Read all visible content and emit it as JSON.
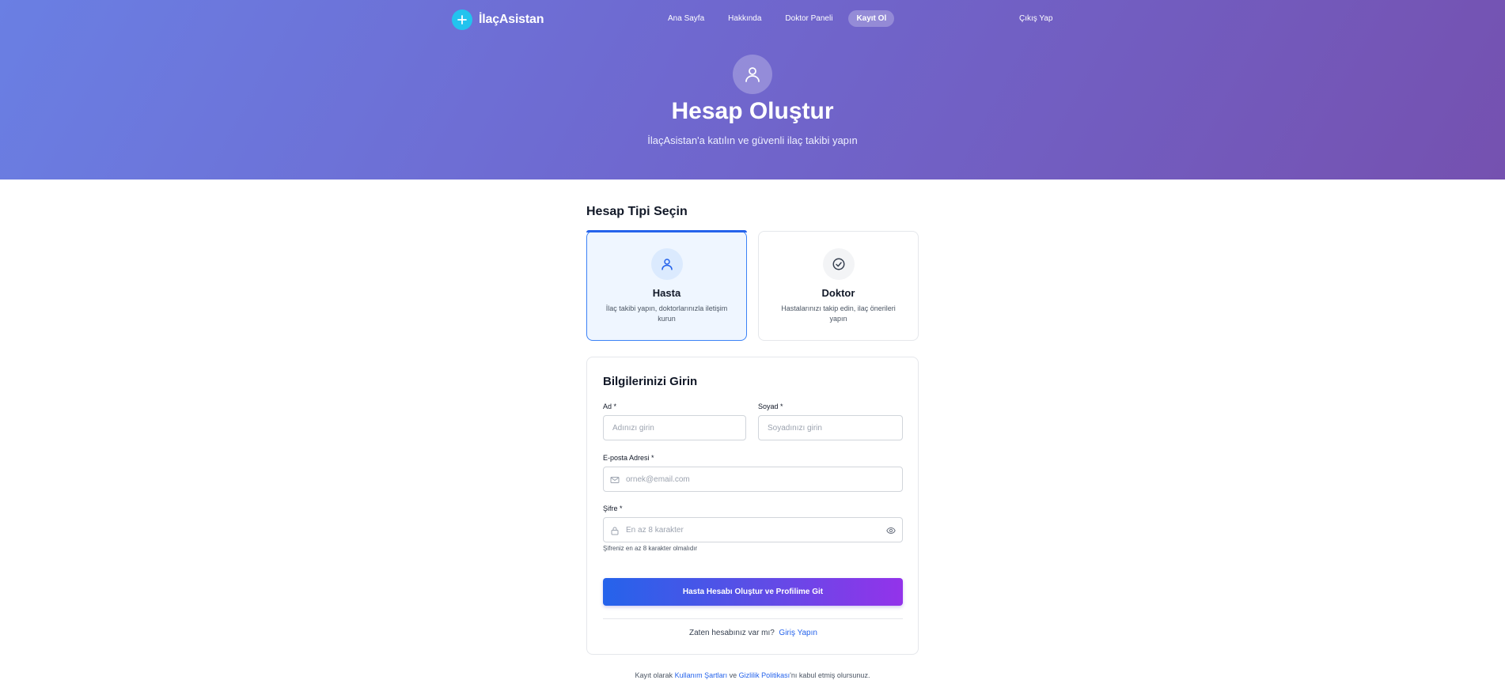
{
  "nav": {
    "brand": "İlaçAsistan",
    "links": [
      "Ana Sayfa",
      "Hakkında",
      "Doktor Paneli",
      "Kayıt Ol"
    ],
    "active_index": 3,
    "logout": "Çıkış Yap"
  },
  "hero": {
    "title": "Hesap Oluştur",
    "subtitle": "İlaçAsistan'a katılın ve güvenli ilaç takibi yapın"
  },
  "account_type": {
    "title": "Hesap Tipi Seçin",
    "options": [
      {
        "label": "Hasta",
        "description": "İlaç takibi yapın, doktorlarınızla iletişim kurun",
        "icon": "user-icon",
        "selected": true
      },
      {
        "label": "Doktor",
        "description": "Hastalarınızı takip edin, ilaç önerileri yapın",
        "icon": "check-circle-icon",
        "selected": false
      }
    ]
  },
  "form": {
    "title": "Bilgilerinizi Girin",
    "first_name": {
      "label": "Ad *",
      "placeholder": "Adınızı girin",
      "value": ""
    },
    "last_name": {
      "label": "Soyad *",
      "placeholder": "Soyadınızı girin",
      "value": ""
    },
    "email": {
      "label": "E-posta Adresi *",
      "placeholder": "ornek@email.com",
      "value": ""
    },
    "password": {
      "label": "Şifre *",
      "placeholder": "En az 8 karakter",
      "value": "",
      "hint": "Şifreniz en az 8 karakter olmalıdır"
    },
    "submit": "Hasta Hesabı Oluştur ve Profilime Git",
    "login_prompt": "Zaten hesabınız var mı?",
    "login_link": "Giriş Yapın"
  },
  "footer": {
    "prefix": "Kayıt olarak",
    "terms": "Kullanım Şartları",
    "and": "ve",
    "privacy": "Gizlilik Politikası",
    "suffix": "'nı kabul etmiş olursunuz."
  },
  "colors": {
    "accent": "#2563eb",
    "brand_badge": "#22c3ee",
    "hero_start": "#6a7fe3",
    "hero_end": "#7551b0",
    "button_end": "#9333ea"
  }
}
